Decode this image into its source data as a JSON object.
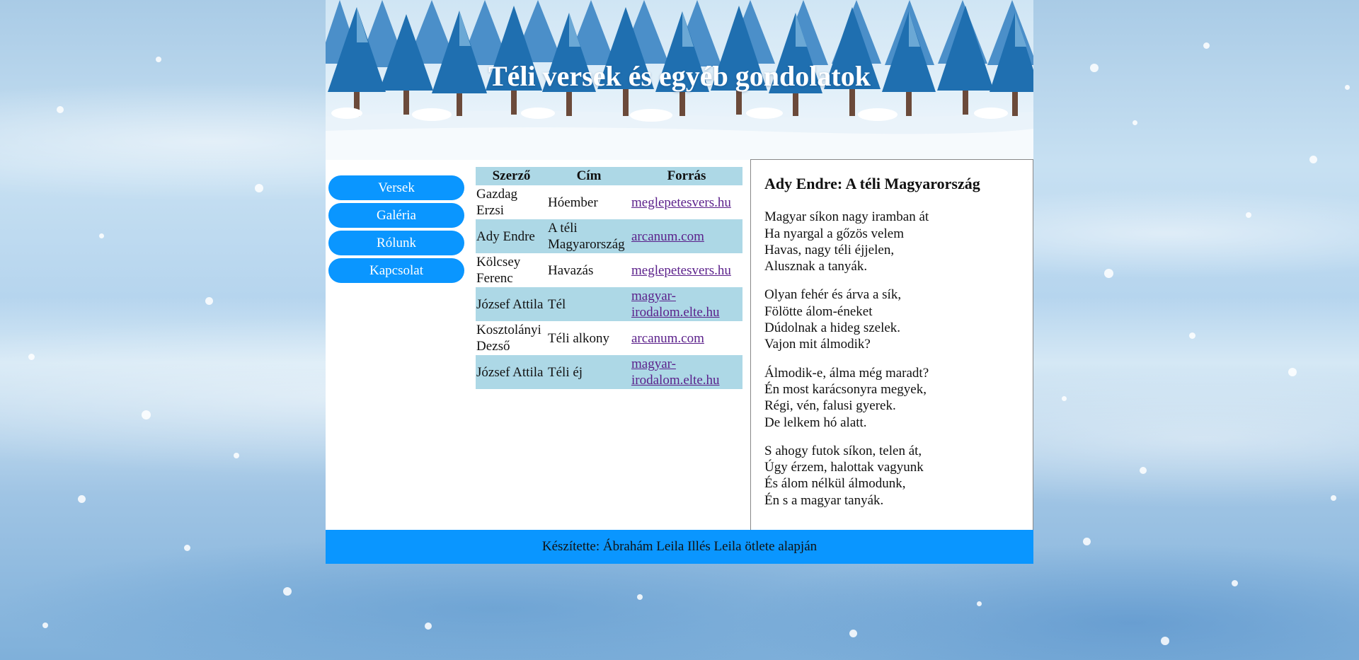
{
  "header": {
    "title": "Téli versek és egyéb gondolatok"
  },
  "nav": {
    "items": [
      {
        "label": "Versek"
      },
      {
        "label": "Galéria"
      },
      {
        "label": "Rólunk"
      },
      {
        "label": "Kapcsolat"
      }
    ]
  },
  "table": {
    "headers": [
      "Szerző",
      "Cím",
      "Forrás"
    ],
    "rows": [
      {
        "author": "Gazdag Erzsi",
        "title": "Hóember",
        "source": "meglepetesvers.hu"
      },
      {
        "author": "Ady Endre",
        "title": "A téli Magyarország",
        "source": "arcanum.com"
      },
      {
        "author": "Kölcsey Ferenc",
        "title": "Havazás",
        "source": "meglepetesvers.hu"
      },
      {
        "author": "József Attila",
        "title": "Tél",
        "source": "magyar-irodalom.elte.hu"
      },
      {
        "author": "Kosztolányi Dezső",
        "title": "Téli alkony",
        "source": "arcanum.com"
      },
      {
        "author": "József Attila",
        "title": "Téli éj",
        "source": "magyar-irodalom.elte.hu"
      }
    ]
  },
  "poem": {
    "title": "Ady Endre: A téli Magyarország",
    "stanzas": [
      [
        "Magyar síkon nagy iramban át",
        "Ha nyargal a gőzös velem",
        "Havas, nagy téli éjjelen,",
        "Alusznak a tanyák."
      ],
      [
        "Olyan fehér és árva a sík,",
        "Fölötte álom-éneket",
        "Dúdolnak a hideg szelek.",
        "Vajon mit álmodik?"
      ],
      [
        "Álmodik-e, álma még maradt?",
        "Én most karácsonyra megyek,",
        "Régi, vén, falusi gyerek.",
        "De lelkem hó alatt."
      ],
      [
        "S ahogy futok síkon, telen át,",
        "Úgy érzem, halottak vagyunk",
        "És álom nélkül álmodunk,",
        "Én s a magyar tanyák."
      ]
    ]
  },
  "footer": {
    "text": "Készítette: Ábrahám Leila Illés Leila ötlete alapján"
  },
  "colors": {
    "nav_button": "#0a96ff",
    "footer": "#0a96ff",
    "table_header": "#add8e6",
    "table_alt_row": "#add8e6",
    "link": "#5a1f8a"
  }
}
